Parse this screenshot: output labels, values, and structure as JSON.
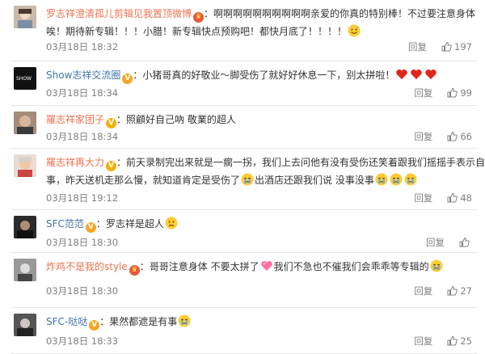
{
  "comments": [
    {
      "user": "罗志祥澄清孤儿剪辑见我置顶微博",
      "badge": "vip",
      "lines": [
        [
          "：啊啊啊啊啊啊啊啊啊啊亲爱的你真的特别棒！不过要注意身体"
        ],
        [
          "唉！期待新专辑！！！小腊！新专辑快点预购吧！都快月底了！！！！",
          "emoji-sweat-smile"
        ]
      ],
      "time": "03月18日 18:32",
      "reply": "回复",
      "likes": "197"
    },
    {
      "user": "Show志祥交流圈",
      "badge": "v-orange",
      "lines": [
        [
          "：小猪哥真的好敬业～脚受伤了就好好休息一下，别太拼啦！",
          "emoji-heart",
          "emoji-heart",
          "emoji-heart"
        ]
      ],
      "time": "03月18日 18:34",
      "reply": "回复",
      "likes": "99"
    },
    {
      "user": "羅志祥家团子",
      "badge": "v-gold",
      "lines": [
        [
          "：照顧好自己吶 敬業的超人"
        ]
      ],
      "time": "03月18日 18:34",
      "reply": "回复",
      "likes": "66"
    },
    {
      "user": "羅志祥再大力",
      "badge": "v-gold",
      "lines": [
        [
          "：前天录制完出来就是一瘸一拐，我们上去问他有没有受伤还笑着跟我们摇摇手表示自己没"
        ],
        [
          "事，昨天送机走那么慢，就知道肯定是受伤了",
          "emoji-cry",
          "出酒店还跟我们说 没事没事",
          "emoji-cry",
          "emoji-cry",
          "emoji-cry"
        ]
      ],
      "time": "03月18日 19:12",
      "reply": "回复",
      "likes": "48"
    },
    {
      "user": "SFC范范",
      "badge": "v-orange",
      "lines": [
        [
          "：罗志祥是超人",
          "emoji-sad"
        ]
      ],
      "time": "03月18日 18:30",
      "reply": "回复",
      "likes": ""
    },
    {
      "user": "炸鸡不是我的style",
      "badge": "vip",
      "lines": [
        [
          "：哥哥注意身体 不要太拼了",
          "emoji-heart-pink",
          "我们不急也不催我们会乖乖等专辑的",
          "emoji-cry"
        ]
      ],
      "time": "03月18日 18:30",
      "reply": "回复",
      "likes": "27"
    },
    {
      "user": "SFC-哒哒",
      "badge": "v-orange",
      "lines": [
        [
          "：果然都遮是有事",
          "emoji-cry"
        ]
      ],
      "time": "03月18日 18:33",
      "reply": "回复",
      "likes": "25"
    }
  ],
  "badge_text": {
    "vip": "♛",
    "v-orange": "V",
    "v-gold": "V"
  },
  "colors": {
    "username": "#eb7350",
    "meta": "#808080",
    "accent_heart": "#e0261b"
  }
}
